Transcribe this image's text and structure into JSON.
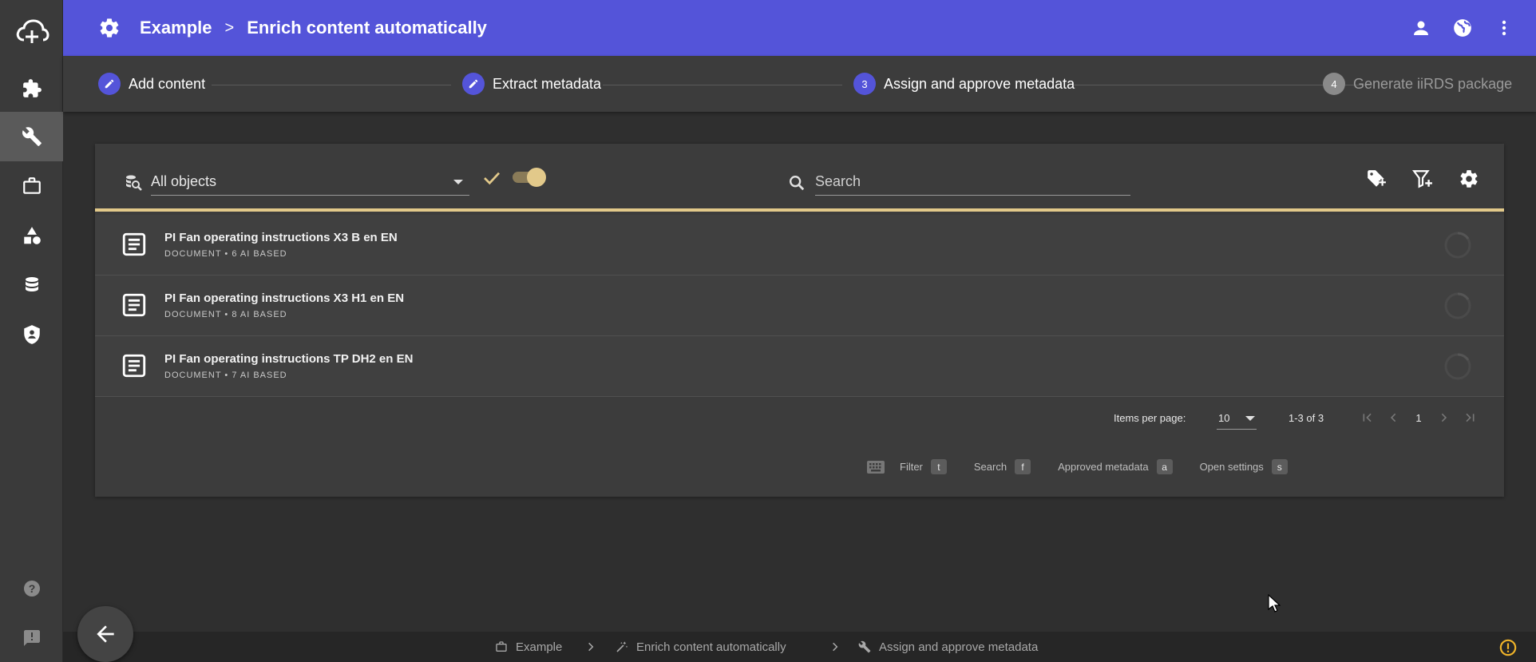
{
  "header": {
    "crumbs": [
      "Example",
      "Enrich content automatically"
    ],
    "separator": ">"
  },
  "stepper": {
    "steps": [
      {
        "label": "Add content",
        "marker": "edit"
      },
      {
        "label": "Extract metadata",
        "marker": "edit"
      },
      {
        "label": "Assign and approve metadata",
        "marker": "3"
      },
      {
        "label": "Generate iiRDS package",
        "marker": "4"
      }
    ]
  },
  "toolbar": {
    "filter_value": "All objects",
    "search_placeholder": "Search"
  },
  "rows": [
    {
      "title": "PI Fan operating instructions X3 B en EN",
      "subtitle": "DOCUMENT • 6 AI BASED"
    },
    {
      "title": "PI Fan operating instructions X3 H1 en EN",
      "subtitle": "DOCUMENT • 8 AI BASED"
    },
    {
      "title": "PI Fan operating instructions TP DH2 en EN",
      "subtitle": "DOCUMENT • 7 AI BASED"
    }
  ],
  "paginator": {
    "items_per_page_label": "Items per page:",
    "items_per_page": "10",
    "range": "1-3 of 3",
    "page": "1"
  },
  "shortcuts": [
    {
      "label": "Filter",
      "key": "t"
    },
    {
      "label": "Search",
      "key": "f"
    },
    {
      "label": "Approved metadata",
      "key": "a"
    },
    {
      "label": "Open settings",
      "key": "s"
    }
  ],
  "footer": {
    "crumbs": [
      "Example",
      "Enrich content automatically",
      "Assign and approve metadata"
    ]
  },
  "colors": {
    "primary": "#5454d9",
    "accent": "#e2c98a",
    "warning": "#f0b429"
  }
}
